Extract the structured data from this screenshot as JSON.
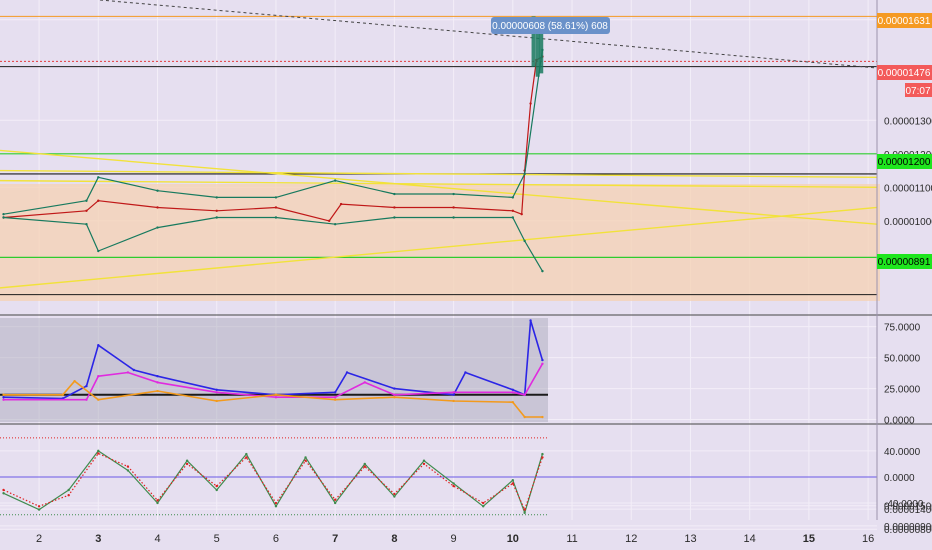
{
  "colors": {
    "background": "#e6dff0",
    "grid": "#f3eef8",
    "orange_zone": "#f5d2b3",
    "price_line": "#c01818",
    "bollinger": "#177a5e",
    "yellow_line": "#f2e23a",
    "green_level": "#2ecc2e",
    "black_level": "#1b1b1b",
    "red_level": "#e23b3b",
    "blue_adx": "#2b25e6",
    "pink_di": "#e02adf",
    "orange_di": "#f39a1c",
    "highlight": "#a7a7b5",
    "stoch_green": "#3f8b4e",
    "stoch_red": "#e02020",
    "momentum_fill": "#9a8ff2",
    "label_orange": "#f59a23",
    "label_red": "#f35a5a",
    "label_green": "#1ee61e",
    "tooltip_bg": "#6a91c9"
  },
  "tooltip": {
    "text": "0.00000608 (58.61%) 608"
  },
  "price_labels": {
    "current_high": "0.00001631",
    "current_price": "0.00001476",
    "timer": "07:07",
    "support_upper": "0.00001200",
    "support_lower": "0.00000891"
  },
  "chart_data": [
    {
      "type": "line",
      "panel": "price",
      "ylim": [
        7.4e-06,
        1.65e-05
      ],
      "y_ticks": [
        1.6e-05,
        1.5e-06,
        1.4e-06,
        1.3e-05,
        1.2e-05,
        1.1e-05,
        1e-05,
        9e-07,
        8e-07
      ],
      "y_tick_labels": [
        "0.00001600",
        "0.00001500",
        "0.00001400",
        "0.00001300",
        "0.00001200",
        "0.00001100",
        "0.00001000",
        "0.00000900",
        "0.00000800"
      ],
      "series": [
        {
          "style": "price",
          "x": [
            1.4,
            2.8,
            3.0,
            4.0,
            5.0,
            6.0,
            6.9,
            7.1,
            8.0,
            9.0,
            10.0,
            10.15,
            10.2,
            10.3,
            10.4,
            10.5
          ],
          "y": [
            1.01e-05,
            1.03e-05,
            1.06e-05,
            1.04e-05,
            1.03e-05,
            1.04e-05,
            1e-05,
            1.05e-05,
            1.04e-05,
            1.04e-05,
            1.03e-05,
            1.02e-05,
            1.15e-05,
            1.35e-05,
            1.48e-05,
            1.49e-05
          ]
        },
        {
          "style": "bollinger",
          "x": [
            1.4,
            2.8,
            3.0,
            4.0,
            5.0,
            6.0,
            7.0,
            8.0,
            9.0,
            10.0,
            10.2,
            10.5
          ],
          "y": [
            1.02e-05,
            1.06e-05,
            1.13e-05,
            1.09e-05,
            1.07e-05,
            1.07e-05,
            1.12e-05,
            1.08e-05,
            1.08e-05,
            1.07e-05,
            1.14e-05,
            1.51e-05
          ]
        },
        {
          "style": "bollinger",
          "x": [
            1.4,
            2.8,
            3.0,
            4.0,
            5.0,
            6.0,
            7.0,
            8.0,
            9.0,
            10.0,
            10.2,
            10.5
          ],
          "y": [
            1.01e-05,
            9.9e-06,
            9.1e-06,
            9.8e-06,
            1.01e-05,
            1.01e-05,
            9.9e-06,
            1.01e-05,
            1.01e-05,
            1.01e-05,
            9.4e-06,
            8.5e-06
          ]
        }
      ]
    },
    {
      "type": "line",
      "panel": "dmi",
      "ylim": [
        -2,
        82
      ],
      "y_ticks": [
        75,
        50,
        25,
        0
      ],
      "y_tick_labels": [
        "75.0000",
        "50.0000",
        "25.0000",
        "0.0000"
      ],
      "series": [
        {
          "style": "adx",
          "x": [
            1.4,
            2.4,
            2.8,
            3.0,
            3.6,
            4.0,
            5.0,
            6.0,
            7.0,
            7.2,
            8.0,
            9.0,
            9.2,
            10.0,
            10.2,
            10.3,
            10.5
          ],
          "y": [
            18,
            17,
            27,
            60,
            40,
            35,
            24,
            20,
            22,
            38,
            25,
            20,
            38,
            24,
            20,
            80,
            48
          ]
        },
        {
          "style": "plus_di",
          "x": [
            1.4,
            2.8,
            3.0,
            3.5,
            4.0,
            5.0,
            6.0,
            7.0,
            7.5,
            8.0,
            9.0,
            10.0,
            10.2,
            10.5
          ],
          "y": [
            16,
            16,
            35,
            38,
            30,
            22,
            18,
            18,
            30,
            20,
            22,
            22,
            20,
            45
          ]
        },
        {
          "style": "minus_di",
          "x": [
            1.4,
            2.4,
            2.6,
            3.0,
            4.0,
            5.0,
            6.0,
            7.0,
            8.0,
            9.0,
            10.0,
            10.2,
            10.5
          ],
          "y": [
            20,
            20,
            31,
            16,
            23,
            15,
            20,
            16,
            18,
            15,
            14,
            2,
            2
          ]
        }
      ]
    },
    {
      "type": "line",
      "panel": "stochastic",
      "ylim": [
        -66,
        72
      ],
      "y_ticks": [
        40,
        0,
        -40
      ],
      "y_tick_labels": [
        "40.0000",
        "0.0000",
        "-40.0000"
      ],
      "series": [
        {
          "style": "stoch_green",
          "x": [
            1.4,
            2.0,
            2.5,
            3.0,
            3.5,
            4.0,
            4.5,
            5.0,
            5.5,
            6.0,
            6.5,
            7.0,
            7.5,
            8.0,
            8.5,
            9.0,
            9.5,
            10.0,
            10.2,
            10.5
          ],
          "y": [
            -25,
            -50,
            -20,
            40,
            10,
            -40,
            25,
            -20,
            35,
            -45,
            30,
            -40,
            20,
            -30,
            25,
            -10,
            -45,
            -5,
            -55,
            35
          ]
        },
        {
          "style": "stoch_red",
          "x": [
            1.4,
            2.0,
            2.5,
            3.0,
            3.5,
            4.0,
            4.5,
            5.0,
            5.5,
            6.0,
            6.5,
            7.0,
            7.5,
            8.0,
            8.5,
            9.0,
            9.5,
            10.0,
            10.2,
            10.5
          ],
          "y": [
            -20,
            -45,
            -28,
            36,
            16,
            -36,
            20,
            -14,
            30,
            -40,
            25,
            -35,
            16,
            -26,
            20,
            -14,
            -40,
            -10,
            -50,
            30
          ]
        }
      ]
    }
  ],
  "x_axis": {
    "ticks": [
      2,
      3,
      4,
      5,
      6,
      7,
      8,
      9,
      10,
      11,
      12,
      13,
      14,
      15,
      16
    ],
    "labels": [
      "2",
      "3",
      "4",
      "5",
      "6",
      "7",
      "8",
      "9",
      "10",
      "11",
      "12",
      "13",
      "14",
      "15",
      "16"
    ],
    "bold": [
      "3",
      "7",
      "8",
      "10",
      "15"
    ],
    "xlim": [
      1.34,
      16.15
    ]
  }
}
